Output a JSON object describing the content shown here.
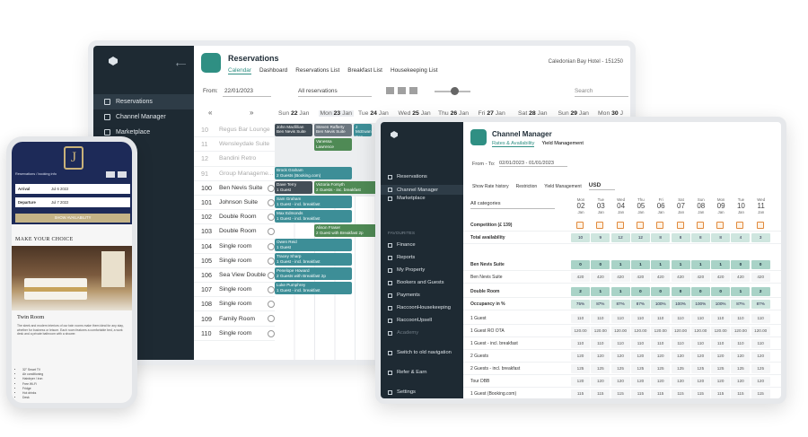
{
  "reservations": {
    "title": "Reservations",
    "tabs": [
      "Calendar",
      "Dashboard",
      "Reservations List",
      "Breakfast List",
      "Housekeeping List"
    ],
    "hotel": "Caledonian Bay Hotel - 151250",
    "sidebar": [
      "Reservations",
      "Channel Manager",
      "Marketplace"
    ],
    "filter": {
      "from_label": "From:",
      "from_date": "22/01/2023",
      "type": "All reservations",
      "search_placeholder": "Search"
    },
    "days": [
      {
        "dow": "Sun",
        "num": "22",
        "mon": "Jan"
      },
      {
        "dow": "Mon",
        "num": "23",
        "mon": "Jan"
      },
      {
        "dow": "Tue",
        "num": "24",
        "mon": "Jan"
      },
      {
        "dow": "Wed",
        "num": "25",
        "mon": "Jan"
      },
      {
        "dow": "Thu",
        "num": "26",
        "mon": "Jan"
      },
      {
        "dow": "Fri",
        "num": "27",
        "mon": "Jan"
      },
      {
        "dow": "Sat",
        "num": "28",
        "mon": "Jan"
      },
      {
        "dow": "Sun",
        "num": "29",
        "mon": "Jan"
      },
      {
        "dow": "Mon",
        "num": "30",
        "mon": "J"
      }
    ],
    "rooms": [
      {
        "n": "10",
        "name": "Regus Bar Lounge",
        "inactive": true
      },
      {
        "n": "11",
        "name": "Wensleydale Suite",
        "inactive": true
      },
      {
        "n": "12",
        "name": "Bandini Retro",
        "inactive": true
      },
      {
        "n": "91",
        "name": "Group Manageme...",
        "inactive": true
      },
      {
        "n": "100",
        "name": "Ben Nevis Suite"
      },
      {
        "n": "101",
        "name": "Johnson Suite"
      },
      {
        "n": "102",
        "name": "Double Room"
      },
      {
        "n": "103",
        "name": "Double Room"
      },
      {
        "n": "104",
        "name": "Single room"
      },
      {
        "n": "105",
        "name": "Single room"
      },
      {
        "n": "106",
        "name": "Sea View Double"
      },
      {
        "n": "107",
        "name": "Single room"
      },
      {
        "n": "108",
        "name": "Single room"
      },
      {
        "n": "109",
        "name": "Family Room"
      },
      {
        "n": "110",
        "name": "Single room"
      }
    ],
    "bookings": [
      {
        "name": "John Macfillian",
        "sub": "Ben Nevis Suite",
        "c": "dark"
      },
      {
        "name": "Steven Rafferty",
        "sub": "Ben Nevis Suite",
        "c": "grey"
      },
      {
        "name": "J McEwan",
        "sub": "Ben Nevis",
        "c": "teal"
      },
      {
        "name": "Vanessa Lawrence",
        "sub": "",
        "c": "green"
      },
      {
        "name": "Brock Graham",
        "sub": "2 Guests (Booking.com)",
        "c": "teal"
      },
      {
        "name": "Dave Terry",
        "sub": "1 Guest",
        "c": "dark"
      },
      {
        "name": "Victoria Forsyth",
        "sub": "2 Guests - inc. breakfast",
        "c": "green"
      },
      {
        "name": "Sam Graham",
        "sub": "1 Guest - incl. breakfast",
        "c": "teal"
      },
      {
        "name": "Max Edmonds",
        "sub": "1 Guest - incl. breakfast",
        "c": "teal"
      },
      {
        "name": "Alison Fraser",
        "sub": "2 Guest with Breakfast 2p",
        "c": "green"
      },
      {
        "name": "Owen Reid",
        "sub": "1 Guest",
        "c": "teal"
      },
      {
        "name": "Tracey Sharp",
        "sub": "1 Guest - incl. breakfast",
        "c": "teal"
      },
      {
        "name": "Penelope Howard",
        "sub": "2 Guests with Breakfast 2p",
        "c": "teal"
      },
      {
        "name": "Luke Pumphrey",
        "sub": "1 Guest - incl. breakfast",
        "c": "teal"
      }
    ]
  },
  "channel": {
    "title": "Channel Manager",
    "tabs": [
      "Rates & Availability",
      "Yield Management"
    ],
    "sidebar": [
      "Reservations",
      "Channel Manager",
      "Marketplace"
    ],
    "section_label": "FAVOURITES",
    "sidebar2": [
      "Finance",
      "Reports",
      "My Property",
      "Bookers and Guests",
      "Payments",
      "RaccoonHousekeeping",
      "RaccoonUpsell",
      "Academy"
    ],
    "bottom": [
      "Switch to old navigation",
      "Refer & Earn",
      "Settings"
    ],
    "range_label": "From - To:",
    "range": "02/01/2023 - 01/01/2023",
    "opts": [
      "Show Rate history",
      "Restriction",
      "Yield Management"
    ],
    "currency": "USD",
    "category": "All categories",
    "cols": [
      {
        "d": "Mon",
        "n": "02",
        "m": "Jan"
      },
      {
        "d": "Tue",
        "n": "03",
        "m": "Jan"
      },
      {
        "d": "Wed",
        "n": "04",
        "m": "Jan"
      },
      {
        "d": "Thu",
        "n": "05",
        "m": "Jan"
      },
      {
        "d": "Fri",
        "n": "06",
        "m": "Jan"
      },
      {
        "d": "Sat",
        "n": "07",
        "m": "Jan"
      },
      {
        "d": "Sun",
        "n": "08",
        "m": "Jan"
      },
      {
        "d": "Mon",
        "n": "09",
        "m": "Jan"
      },
      {
        "d": "Tue",
        "n": "10",
        "m": "Jan"
      },
      {
        "d": "Wed",
        "n": "11",
        "m": "Jan"
      }
    ],
    "rows": [
      {
        "label": "Competition (£ 139)",
        "bold": true,
        "style": "sq",
        "vals": [
          "",
          "",
          "",
          "",
          "",
          "",
          "",
          "",
          "",
          ""
        ]
      },
      {
        "label": "Total availability",
        "bold": true,
        "style": "g",
        "vals": [
          "10",
          "9",
          "12",
          "12",
          "8",
          "8",
          "8",
          "8",
          "4",
          "3"
        ]
      },
      {
        "label": "Ben Nevis Suite",
        "bold": true,
        "style": "gd",
        "vals": [
          "0",
          "0",
          "1",
          "1",
          "1",
          "1",
          "1",
          "1",
          "0",
          "0"
        ]
      },
      {
        "label": "Ben Nevis Suite",
        "bold": false,
        "style": "w",
        "vals": [
          "420",
          "420",
          "420",
          "420",
          "420",
          "420",
          "420",
          "420",
          "420",
          "420"
        ]
      },
      {
        "label": "Double Room",
        "bold": true,
        "style": "gd",
        "vals": [
          "2",
          "1",
          "1",
          "0",
          "0",
          "0",
          "0",
          "0",
          "1",
          "2"
        ]
      },
      {
        "label": "Occupancy in %",
        "bold": true,
        "style": "g",
        "vals": [
          "75%",
          "87%",
          "87%",
          "87%",
          "100%",
          "100%",
          "100%",
          "100%",
          "87%",
          "87%"
        ]
      },
      {
        "label": "1 Guest",
        "bold": false,
        "style": "w",
        "vals": [
          "110",
          "110",
          "110",
          "110",
          "110",
          "110",
          "110",
          "110",
          "110",
          "110"
        ]
      },
      {
        "label": "1 Guest RO OTA",
        "bold": false,
        "style": "w",
        "vals": [
          "120.00",
          "120.00",
          "120.00",
          "120.00",
          "120.00",
          "120.00",
          "120.00",
          "120.00",
          "120.00",
          "120.00"
        ]
      },
      {
        "label": "1 Guest - incl. breakfast",
        "bold": false,
        "style": "w",
        "vals": [
          "110",
          "110",
          "110",
          "110",
          "110",
          "110",
          "110",
          "110",
          "110",
          "110"
        ]
      },
      {
        "label": "2 Guests",
        "bold": false,
        "style": "w",
        "vals": [
          "120",
          "120",
          "120",
          "120",
          "120",
          "120",
          "120",
          "120",
          "120",
          "120"
        ]
      },
      {
        "label": "2 Guests - incl. breakfast",
        "bold": false,
        "style": "w",
        "vals": [
          "125",
          "125",
          "125",
          "125",
          "125",
          "125",
          "125",
          "125",
          "125",
          "125"
        ]
      },
      {
        "label": "Tour DBB",
        "bold": false,
        "style": "w",
        "vals": [
          "120",
          "120",
          "120",
          "120",
          "120",
          "120",
          "120",
          "120",
          "120",
          "120"
        ]
      },
      {
        "label": "1 Guest (Booking.com)",
        "bold": false,
        "style": "w",
        "vals": [
          "115",
          "115",
          "115",
          "115",
          "115",
          "115",
          "115",
          "115",
          "115",
          "115"
        ]
      }
    ]
  },
  "phone": {
    "booking_text": "Reservations / booking info",
    "arrival_label": "Arrival",
    "arrival": "Jul 6 2022",
    "departure_label": "Departure",
    "departure": "Jul 7 2022",
    "button": "SHOW AVAILABILITY",
    "choice": "MAKE YOUR CHOICE",
    "room": "Twin Room",
    "desc": "The sleek and modern interiors of our twin rooms make them ideal for any stay, whether for business or leisure. Each room features a comfortable bed, a work desk and a private bathroom with a shower.",
    "features": [
      "32\" Smart TV",
      "Air conditioning",
      "Hairdryer / iron",
      "Free Wi-Fi",
      "Fridge",
      "Hot drinks",
      "Desk"
    ]
  },
  "colors": {
    "teal": "#3d8e97",
    "green": "#4f8a55",
    "dark": "#434e57",
    "sidebar": "#1e2a33",
    "accent": "#2f8f83",
    "phone_header": "#1d2a58",
    "gold": "#c4b386"
  }
}
